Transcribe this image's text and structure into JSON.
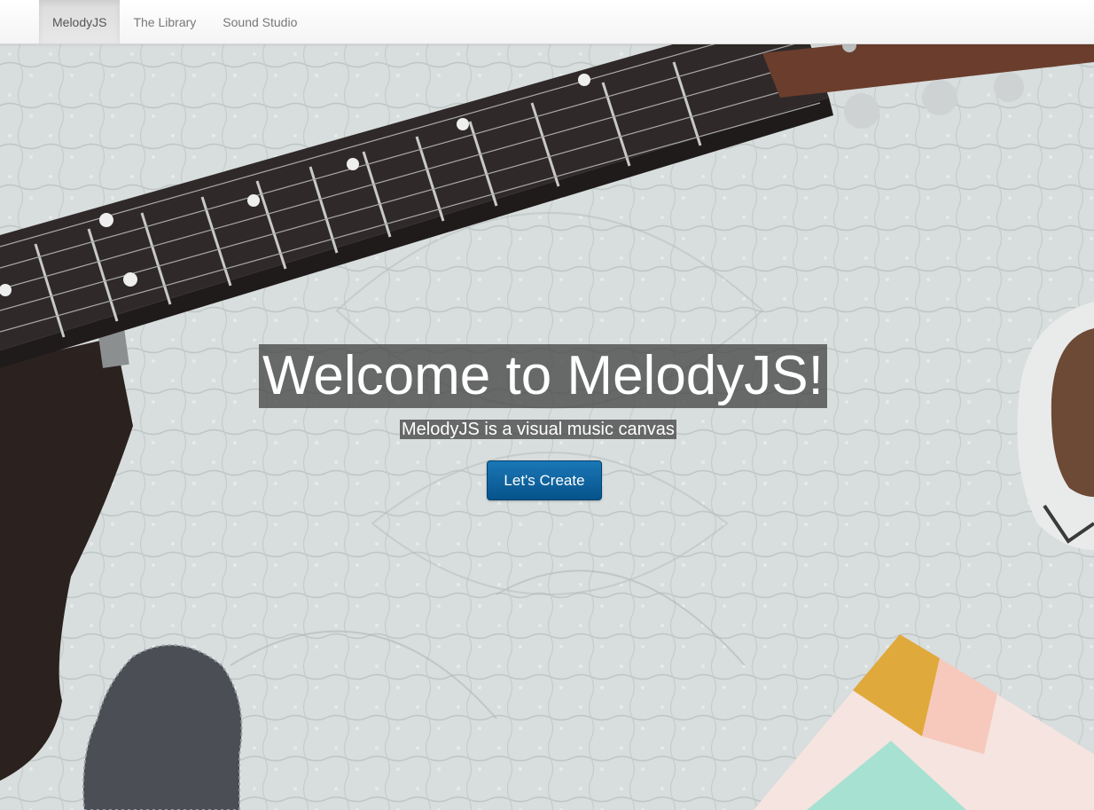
{
  "nav": {
    "items": [
      {
        "label": "MelodyJS",
        "active": true
      },
      {
        "label": "The Library",
        "active": false
      },
      {
        "label": "Sound Studio",
        "active": false
      }
    ]
  },
  "hero": {
    "title": "Welcome to MelodyJS!",
    "subtitle": "MelodyJS is a visual music canvas",
    "cta_label": "Let's Create",
    "background_scene": "guitar-on-quilt-photo"
  },
  "colors": {
    "button_primary": "#0d67a6",
    "quilt": "#d9dede",
    "fretboard": "#2e2a29"
  }
}
